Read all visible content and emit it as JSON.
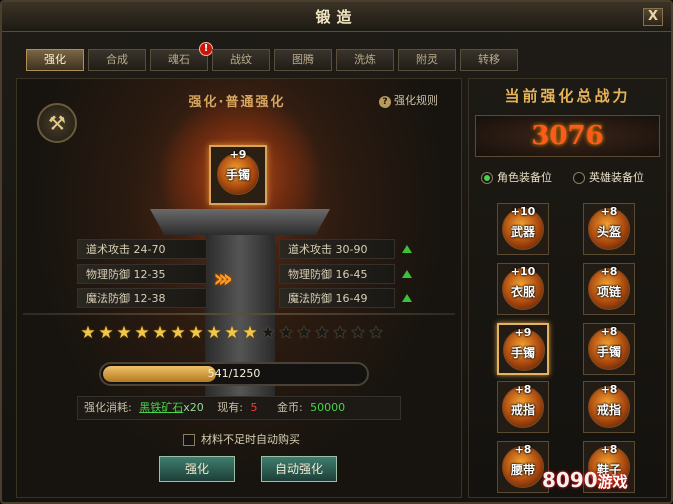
{
  "window": {
    "title": "锻造",
    "close_label": "X"
  },
  "tabs": [
    {
      "label": "强化",
      "active": true
    },
    {
      "label": "合成"
    },
    {
      "label": "魂石",
      "alert": "!"
    },
    {
      "label": "战纹"
    },
    {
      "label": "图腾"
    },
    {
      "label": "洗炼"
    },
    {
      "label": "附灵"
    },
    {
      "label": "转移"
    }
  ],
  "forge": {
    "mode_title": "强化·普通强化",
    "rules_label": "强化规则",
    "rules_icon": "?",
    "item": {
      "name": "手镯",
      "level": "+9"
    },
    "current_stats": [
      "道术攻击 24-70",
      "物理防御 12-35",
      "魔法防御 12-38"
    ],
    "next_stats": [
      "道术攻击 30-90",
      "物理防御 16-45",
      "魔法防御 16-49"
    ],
    "stars": {
      "filled": 10,
      "total": 17
    },
    "progress": {
      "text": "541/1250",
      "fraction": 0.4328
    },
    "cost": {
      "label": "强化消耗:",
      "material": "黑铁矿石",
      "material_qty": "x20",
      "owned_label": "现有:",
      "owned_value": "5",
      "gold_label": "金币:",
      "gold_value": "50000"
    },
    "auto_buy_label": "材料不足时自动购买",
    "enhance_button": "强化",
    "auto_enhance_button": "自动强化"
  },
  "power": {
    "header": "当前强化总战力",
    "value": "3076",
    "radio_character": "角色装备位",
    "radio_hero": "英雄装备位"
  },
  "slots": [
    {
      "name": "武器",
      "level": "+10"
    },
    {
      "name": "头盔",
      "level": "+8"
    },
    {
      "name": "衣服",
      "level": "+10"
    },
    {
      "name": "项链",
      "level": "+8"
    },
    {
      "name": "手镯",
      "level": "+9"
    },
    {
      "name": "手镯",
      "level": "+8"
    },
    {
      "name": "戒指",
      "level": "+8"
    },
    {
      "name": "戒指",
      "level": "+8"
    },
    {
      "name": "腰带",
      "level": "+8"
    },
    {
      "name": "鞋子",
      "level": "+8"
    }
  ],
  "watermark": {
    "brand": "8090",
    "suffix": "游戏"
  },
  "colors": {
    "accent": "#e5b460",
    "stat_up": "#3ac23a",
    "power": "#ff5a1c"
  }
}
